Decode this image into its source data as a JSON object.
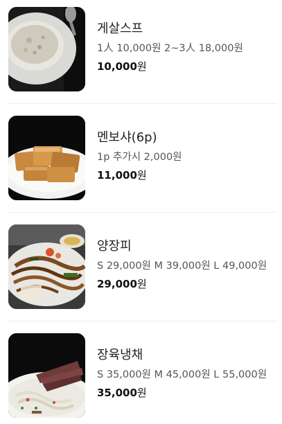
{
  "menu": {
    "items": [
      {
        "name": "게살스프",
        "description": "1人 10,000원 2~3人 18,000원",
        "price": "10,000",
        "currency": "원",
        "image_icon": "crab-soup-photo"
      },
      {
        "name": "멘보샤(6p)",
        "description": "1p 추가시 2,000원",
        "price": "11,000",
        "currency": "원",
        "image_icon": "shrimp-toast-photo"
      },
      {
        "name": "양장피",
        "description": "S 29,000원 M 39,000원 L 49,000원",
        "price": "29,000",
        "currency": "원",
        "image_icon": "yangjangpi-photo"
      },
      {
        "name": "장육냉채",
        "description": "S 35,000원 M 45,000원 L 55,000원",
        "price": "35,000",
        "currency": "원",
        "image_icon": "cold-beef-salad-photo"
      }
    ]
  }
}
